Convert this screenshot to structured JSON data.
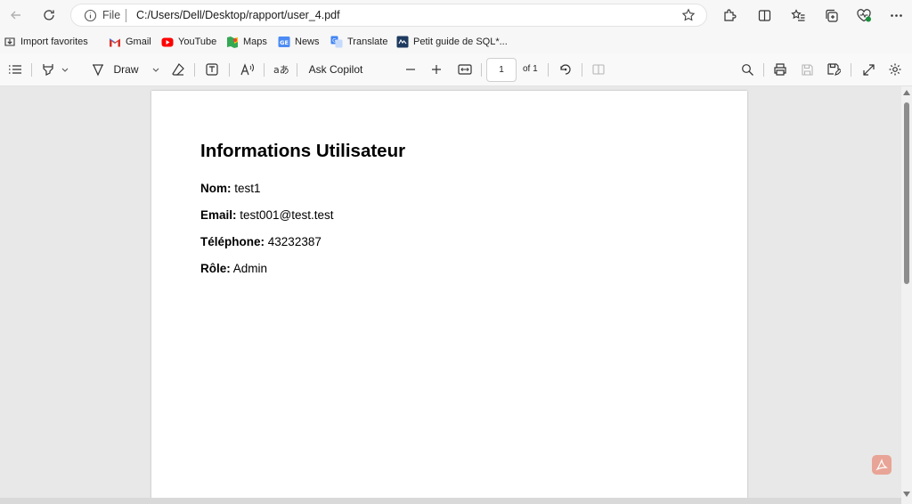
{
  "browser": {
    "url_scheme_label": "File",
    "url": "C:/Users/Dell/Desktop/rapport/user_4.pdf"
  },
  "bookmarks": [
    {
      "label": "Import favorites",
      "icon": "import-icon"
    },
    {
      "label": "Gmail",
      "icon": "gmail-icon"
    },
    {
      "label": "YouTube",
      "icon": "youtube-icon"
    },
    {
      "label": "Maps",
      "icon": "maps-icon"
    },
    {
      "label": "News",
      "icon": "news-icon"
    },
    {
      "label": "Translate",
      "icon": "translate-icon"
    },
    {
      "label": "Petit guide de SQL*...",
      "icon": "bookmark-page-icon"
    }
  ],
  "pdf_toolbar": {
    "draw_label": "Draw",
    "ask_copilot_label": "Ask Copilot",
    "page_number": "1",
    "page_of": "of 1"
  },
  "document": {
    "title": "Informations Utilisateur",
    "fields": [
      {
        "label": "Nom:",
        "value": "test1"
      },
      {
        "label": "Email:",
        "value": "test001@test.test"
      },
      {
        "label": "Téléphone:",
        "value": "43232387"
      },
      {
        "label": "Rôle:",
        "value": "Admin"
      }
    ]
  },
  "colors": {
    "toolbar_bg": "#f7f7f7",
    "viewer_bg": "#e8e8e8",
    "page_bg": "#ffffff",
    "youtube_red": "#ff0000",
    "acrobat_badge": "#e8a496"
  }
}
